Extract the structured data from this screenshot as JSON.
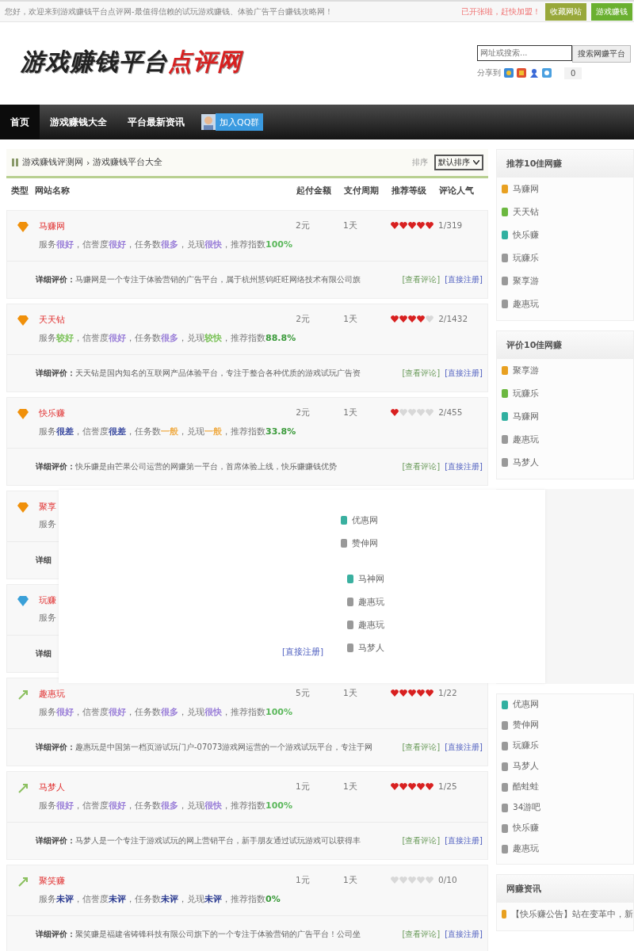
{
  "top_bar": {
    "welcome": "您好，欢迎来到游戏赚钱平台点评网-最值得信赖的试玩游戏赚钱、体验广告平台赚钱攻略网！",
    "notice": "已开张啦，赶快加盟！",
    "buttons": [
      "收藏网站",
      "游戏赚钱"
    ]
  },
  "header": {
    "logo_main": "游戏赚钱平台",
    "logo_accent": "点评网",
    "search": {
      "placeholder": "网址或搜索..."
    },
    "search_button": "搜索网赚平台",
    "share_label": "分享到",
    "share_count": "0"
  },
  "nav": {
    "items": [
      {
        "label": "首页",
        "selected": true
      },
      {
        "label": "游戏赚钱大全",
        "selected": false
      },
      {
        "label": "平台最新资讯",
        "selected": false
      }
    ],
    "qq_button": "加入QQ群"
  },
  "breadcrumb": {
    "items": [
      "游戏赚钱评测网",
      "游戏赚钱平台大全"
    ],
    "separator": "›",
    "sort_label": "排序",
    "sort_value": "默认排序"
  },
  "table": {
    "columns": [
      "类型",
      "网站名称",
      "起付金额",
      "支付周期",
      "推荐等级",
      "评论人气"
    ],
    "rows": [
      {
        "kind": "diamond",
        "color": "#f0900a",
        "name": "马赚网",
        "min_pay": "2元",
        "cycle": "1天",
        "stars": 5,
        "popularity": "1/319",
        "info": [
          {
            "label": "服务",
            "value": "很好",
            "color": "#9a7fd8"
          },
          {
            "label": "，信誉度",
            "value": "很好",
            "color": "#9a7fd8"
          },
          {
            "label": "，任务数",
            "value": "很多",
            "color": "#9a7fd8"
          },
          {
            "label": "，兑现",
            "value": "很快",
            "color": "#9a7fd8"
          },
          {
            "label": "，推荐指数",
            "value": "100%",
            "color": "#5cb85c"
          }
        ],
        "review_label": "详细评价：",
        "review": "马赚网是一个专注于体验营销的广告平台，属于杭州慧钨旺旺网络技术有限公司旗",
        "links": [
          "[查看评论]",
          "[直接注册]"
        ]
      },
      {
        "kind": "diamond",
        "color": "#f0900a",
        "name": "天天钻",
        "min_pay": "2元",
        "cycle": "1天",
        "stars": 4,
        "popularity": "2/1432",
        "info": [
          {
            "label": "服务",
            "value": "较好",
            "color": "#7cc25a"
          },
          {
            "label": "，信誉度",
            "value": "很好",
            "color": "#9a7fd8"
          },
          {
            "label": "，任务数",
            "value": "很多",
            "color": "#9a7fd8"
          },
          {
            "label": "，兑现",
            "value": "较快",
            "color": "#7cc25a"
          },
          {
            "label": "，推荐指数",
            "value": "88.8%",
            "color": "#3a9a3a"
          }
        ],
        "review_label": "详细评价：",
        "review": "天天钻是国内知名的互联网产品体验平台，专注于整合各种优质的游戏试玩广告资",
        "links": [
          "[查看评论]",
          "[直接注册]"
        ]
      },
      {
        "kind": "diamond",
        "color": "#f0900a",
        "name": "快乐赚",
        "min_pay": "2元",
        "cycle": "1天",
        "stars": 1,
        "popularity": "2/455",
        "info": [
          {
            "label": "服务",
            "value": "很差",
            "color": "#3a4aa0"
          },
          {
            "label": "，信誉度",
            "value": "很差",
            "color": "#3a4aa0"
          },
          {
            "label": "，任务数",
            "value": "一般",
            "color": "#f0b050"
          },
          {
            "label": "，兑现",
            "value": "一般",
            "color": "#f0b050"
          },
          {
            "label": "，推荐指数",
            "value": "33.8%",
            "color": "#3a9a3a"
          }
        ],
        "review_label": "详细评价：",
        "review": "快乐赚是由芒果公司运营的网赚第一平台，首席体验上线，快乐赚赚钱优势",
        "links": [
          "[查看评论]",
          "[直接注册]"
        ]
      },
      {
        "kind": "diamond",
        "color": "#f0900a",
        "name": "聚享",
        "info_text": "服务",
        "review_label": "详细"
      },
      {
        "kind": "diamond",
        "color": "#3aa0d8",
        "name": "玩赚",
        "info_text": "服务",
        "review_label": "详细"
      },
      {
        "kind": "arrow",
        "color": "#8cc060",
        "name": "趣惠玩",
        "min_pay": "5元",
        "cycle": "1天",
        "stars": 5,
        "popularity": "1/22",
        "info": [
          {
            "label": "服务",
            "value": "很好",
            "color": "#9a7fd8"
          },
          {
            "label": "，信誉度",
            "value": "很好",
            "color": "#9a7fd8"
          },
          {
            "label": "，任务数",
            "value": "很多",
            "color": "#9a7fd8"
          },
          {
            "label": "，兑现",
            "value": "很快",
            "color": "#9a7fd8"
          },
          {
            "label": "，推荐指数",
            "value": "100%",
            "color": "#5cb85c"
          }
        ],
        "review_label": "详细评价：",
        "review": "趣惠玩是中国第一档页游试玩门户-07073游戏网运营的一个游戏试玩平台，专注于网",
        "links": [
          "[查看评论]",
          "[直接注册]"
        ]
      },
      {
        "kind": "arrow",
        "color": "#8cc060",
        "name": "马梦人",
        "min_pay": "1元",
        "cycle": "1天",
        "stars": 5,
        "popularity": "1/25",
        "info": [
          {
            "label": "服务",
            "value": "很好",
            "color": "#9a7fd8"
          },
          {
            "label": "，信誉度",
            "value": "很好",
            "color": "#9a7fd8"
          },
          {
            "label": "，任务数",
            "value": "很多",
            "color": "#9a7fd8"
          },
          {
            "label": "，兑现",
            "value": "很快",
            "color": "#9a7fd8"
          },
          {
            "label": "，推荐指数",
            "value": "100%",
            "color": "#5cb85c"
          }
        ],
        "review_label": "详细评价：",
        "review": "马梦人是一个专注于游戏试玩的网上营销平台，新手朋友通过试玩游戏可以获得丰",
        "links": [
          "[查看评论]",
          "[直接注册]"
        ]
      },
      {
        "kind": "arrow",
        "color": "#8cc060",
        "name": "聚笑赚",
        "min_pay": "1元",
        "cycle": "1天",
        "stars": 0,
        "popularity": "0/10",
        "info": [
          {
            "label": "服务",
            "value": "未评",
            "color": "#2a3a90"
          },
          {
            "label": "，信誉度",
            "value": "未评",
            "color": "#2a3a90"
          },
          {
            "label": "，任务数",
            "value": "未评",
            "color": "#2a3a90"
          },
          {
            "label": "，兑现",
            "value": "未评",
            "color": "#2a3a90"
          },
          {
            "label": "，推荐指数",
            "value": "0%",
            "color": "#3a9a3a"
          }
        ],
        "review_label": "详细评价：",
        "review": "聚笑赚是福建省铸锋科技有限公司旗下的一个专注于体验营销的广告平台！公司坐",
        "links": [
          "[查看评论]",
          "[直接注册]"
        ]
      }
    ]
  },
  "overlay": {
    "link": "[直接注册]",
    "groups": [
      [
        {
          "name": "优惠网",
          "color": "#3ab0a0"
        },
        {
          "name": "赞伸网",
          "color": "#999999"
        }
      ],
      [
        {
          "name": "马神网",
          "color": "#3ab0a0"
        },
        {
          "name": "趣惠玩",
          "color": "#999999"
        },
        {
          "name": "趣惠玩",
          "color": "#999999"
        },
        {
          "name": "马梦人",
          "color": "#999999"
        }
      ]
    ]
  },
  "sidebar": {
    "boxes": [
      {
        "title": "推荐10佳网赚",
        "items": [
          {
            "name": "马赚网",
            "color": "#e8a020"
          },
          {
            "name": "天天钻",
            "color": "#6cb840"
          },
          {
            "name": "快乐赚",
            "color": "#30b0a0"
          },
          {
            "name": "玩赚乐",
            "color": "#999999"
          },
          {
            "name": "聚享游",
            "color": "#999999"
          },
          {
            "name": "趣惠玩",
            "color": "#999999"
          }
        ]
      },
      {
        "title": "评价10佳网赚",
        "items": [
          {
            "name": "聚享游",
            "color": "#e8a020"
          },
          {
            "name": "玩赚乐",
            "color": "#6cb840"
          },
          {
            "name": "马赚网",
            "color": "#30b0a0"
          },
          {
            "name": "趣惠玩",
            "color": "#999999"
          },
          {
            "name": "马梦人",
            "color": "#999999"
          }
        ]
      },
      {
        "items": [
          {
            "name": "优惠网",
            "color": "#30b0a0"
          },
          {
            "name": "赞伸网",
            "color": "#999999"
          },
          {
            "name": "玩赚乐",
            "color": "#999999"
          },
          {
            "name": "马梦人",
            "color": "#999999"
          },
          {
            "name": "酷蛙蛙",
            "color": "#999999"
          },
          {
            "name": "34游吧",
            "color": "#999999"
          },
          {
            "name": "快乐赚",
            "color": "#999999"
          },
          {
            "name": "趣惠玩",
            "color": "#999999"
          }
        ]
      },
      {
        "title": "网赚资讯",
        "items": [
          {
            "name": "【快乐赚公告】站在变革中，新",
            "color": "#e8a020"
          }
        ]
      }
    ]
  }
}
